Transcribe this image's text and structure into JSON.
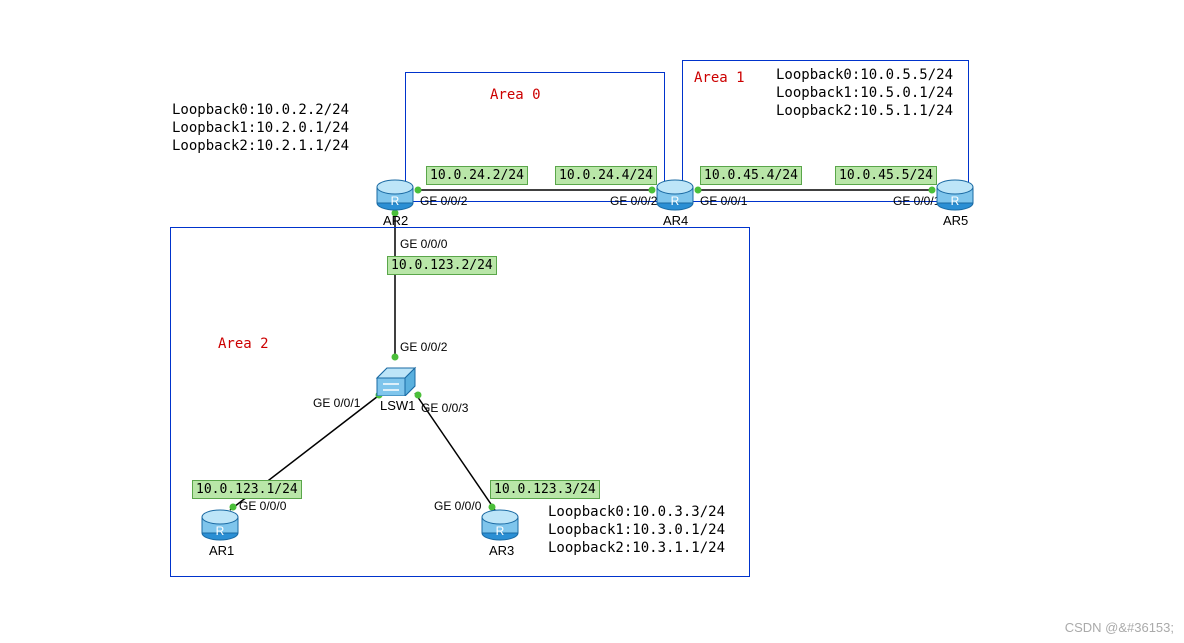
{
  "areas": {
    "area0": {
      "label": "Area 0"
    },
    "area1": {
      "label": "Area 1"
    },
    "area2": {
      "label": "Area 2"
    }
  },
  "devices": {
    "ar1": {
      "label": "AR1"
    },
    "ar2": {
      "label": "AR2"
    },
    "ar3": {
      "label": "AR3"
    },
    "ar4": {
      "label": "AR4"
    },
    "ar5": {
      "label": "AR5"
    },
    "lsw1": {
      "label": "LSW1"
    }
  },
  "loopbacks": {
    "ar2": {
      "l0": "Loopback0:10.0.2.2/24",
      "l1": "Loopback1:10.2.0.1/24",
      "l2": "Loopback2:10.2.1.1/24"
    },
    "ar5": {
      "l0": "Loopback0:10.0.5.5/24",
      "l1": "Loopback1:10.5.0.1/24",
      "l2": "Loopback2:10.5.1.1/24"
    },
    "ar3": {
      "l0": "Loopback0:10.0.3.3/24",
      "l1": "Loopback1:10.3.0.1/24",
      "l2": "Loopback2:10.3.1.1/24"
    }
  },
  "ips": {
    "ar2_ge002": "10.0.24.2/24",
    "ar4_ge002": "10.0.24.4/24",
    "ar4_ge001": "10.0.45.4/24",
    "ar5_ge001": "10.0.45.5/24",
    "ar2_ge000": "10.0.123.2/24",
    "ar1_ge000": "10.0.123.1/24",
    "ar3_ge000": "10.0.123.3/24"
  },
  "ports": {
    "ge000": "GE 0/0/0",
    "ge001": "GE 0/0/1",
    "ge002": "GE 0/0/2",
    "ge003": "GE 0/0/3"
  },
  "watermark": "CSDN @&#36153;"
}
